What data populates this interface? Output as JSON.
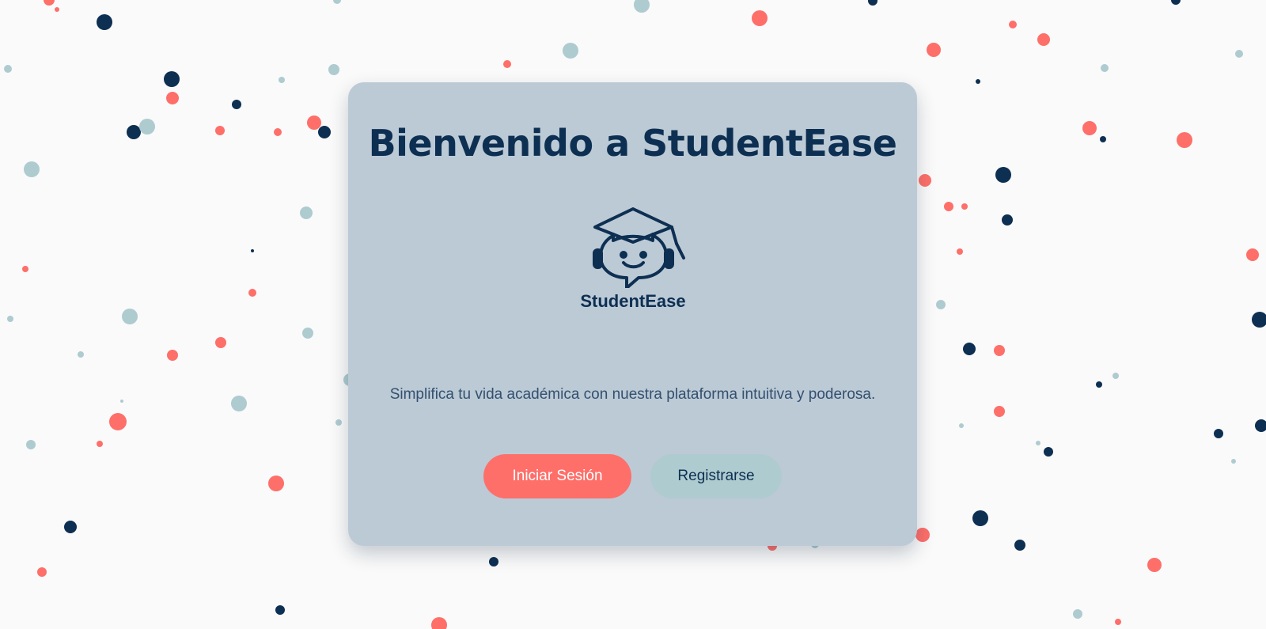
{
  "colors": {
    "background": "#fafafa",
    "card": "#bccad6",
    "navy": "#0d2f52",
    "coral": "#fe6f6a",
    "teal": "#aecbd0"
  },
  "welcome": {
    "title": "Bienvenido a StudentEase",
    "logo_text": "StudentEase",
    "subtitle": "Simplifica tu vida académica con nuestra plataforma intuitiva y poderosa."
  },
  "actions": {
    "login_label": "Iniciar Sesión",
    "register_label": "Registrarse"
  }
}
